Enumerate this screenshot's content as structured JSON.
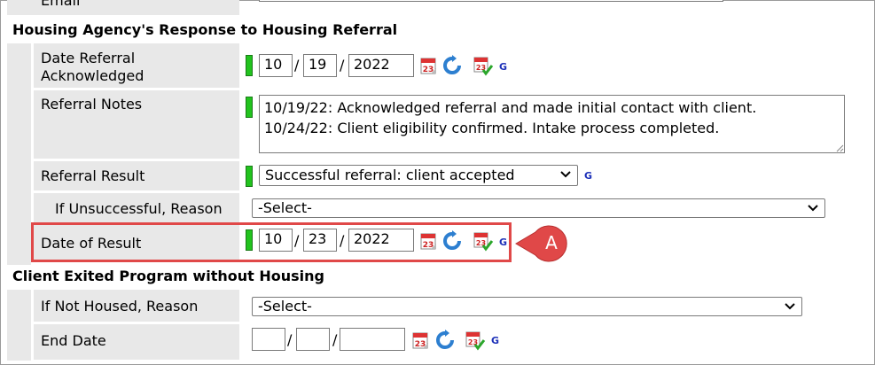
{
  "form": {
    "email_label": "Email",
    "section1_title": "Housing Agency's Response to Housing Referral",
    "date_referral_acknowledged": {
      "label_line1": "Date Referral",
      "label_line2": "Acknowledged",
      "month": "10",
      "day": "19",
      "year": "2022",
      "g_link": "G"
    },
    "referral_notes": {
      "label": "Referral Notes",
      "text": "10/19/22: Acknowledged referral and made initial contact with client.\n10/24/22: Client eligibility confirmed. Intake process completed."
    },
    "referral_result": {
      "label": "Referral Result",
      "selected": "Successful referral: client accepted",
      "g_link": "G"
    },
    "if_unsuccessful_reason": {
      "label": "If Unsuccessful, Reason",
      "selected": "-Select-"
    },
    "date_of_result": {
      "label": "Date of Result",
      "month": "10",
      "day": "23",
      "year": "2022",
      "g_link": "G"
    },
    "section2_title": "Client Exited Program without Housing",
    "if_not_housed_reason": {
      "label": "If Not Housed, Reason",
      "selected": "-Select-"
    },
    "end_date": {
      "label": "End Date",
      "month": "",
      "day": "",
      "year": "",
      "g_link": "G"
    }
  },
  "annotation": {
    "callout_label": "A"
  },
  "colors": {
    "required_indicator": "#22c31e",
    "highlight_border": "#e04848",
    "callout_fill": "#e04848",
    "label_bg": "#e8e8e8",
    "g_link": "#1b2fb8"
  },
  "icons": [
    "calendar-icon",
    "refresh-icon",
    "calendar-check-icon",
    "chevron-down-icon"
  ]
}
